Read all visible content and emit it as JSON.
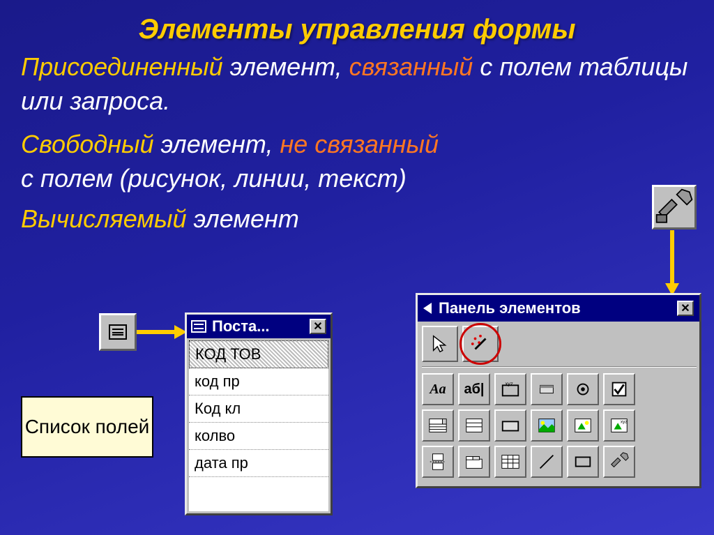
{
  "title": "Элементы управления формы",
  "paragraph": {
    "line1a": "Присоединенный",
    "line1b": " элемент, ",
    "line1c": "связанный",
    "line1d": " с полем таблицы или запроса.",
    "line2a": "Свободный",
    "line2b": " элемент, ",
    "line2c": "не связанный",
    "line3": "с полем  (рисунок, линии, текст)",
    "line4a": "Вычисляемый",
    "line4b": " элемент"
  },
  "fieldlist_label": "Список полей",
  "field_window": {
    "title": "Поста...",
    "rows": [
      "КОД ТОВ",
      "код пр",
      "Код кл",
      "колво",
      "дата пр"
    ]
  },
  "toolbox": {
    "title": "Панель элементов",
    "close": "✕"
  }
}
